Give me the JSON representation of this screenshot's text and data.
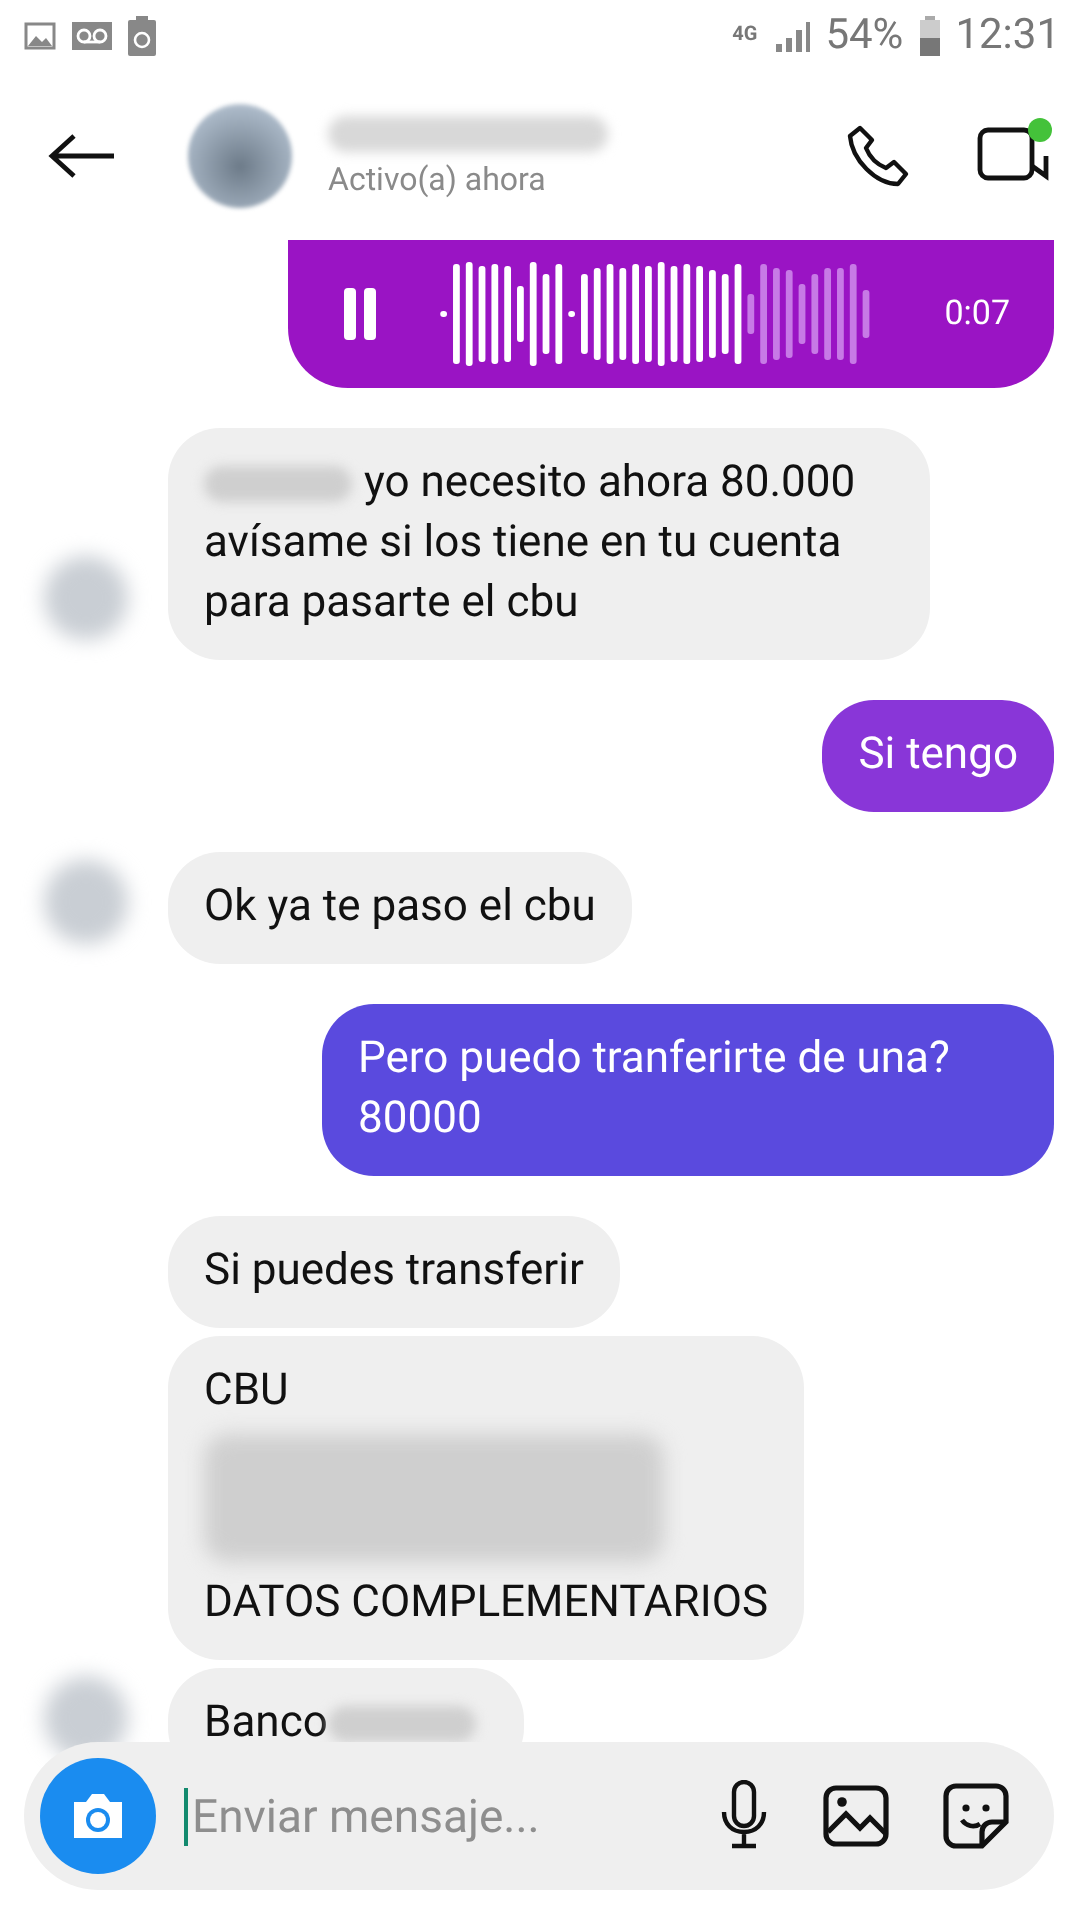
{
  "status_bar": {
    "network": "4G",
    "battery": "54%",
    "time": "12:31"
  },
  "header": {
    "status": "Activo(a) ahora",
    "online": true
  },
  "messages": [
    {
      "kind": "voice",
      "duration": "0:07",
      "level": 0.72
    },
    {
      "kind": "incoming",
      "avatar": true,
      "content": [
        {
          "kind": "redacted"
        },
        {
          "kind": "text",
          "text": "yo necesito ahora 80.000"
        },
        {
          "kind": "line",
          "text": "avísame si los tiene en tu cuenta para pasarte el cbu"
        }
      ]
    },
    {
      "kind": "outgoing",
      "color": "#8936d8",
      "content": [
        {
          "kind": "text",
          "text": "Si tengo"
        }
      ]
    },
    {
      "kind": "incoming",
      "avatar": true,
      "content": [
        {
          "kind": "text",
          "text": "Ok ya te paso el cbu"
        }
      ]
    },
    {
      "kind": "outgoing",
      "color": "#5a4ade",
      "content": [
        {
          "kind": "text",
          "text": "Pero puedo tranferirte de una? 80000"
        }
      ]
    },
    {
      "kind": "incoming",
      "avatar": false,
      "content": [
        {
          "kind": "text",
          "text": "Si puedes transferir"
        }
      ]
    },
    {
      "kind": "incoming",
      "avatar": false,
      "content": [
        {
          "kind": "line",
          "text": "CBU"
        },
        {
          "kind": "redacted_block"
        },
        {
          "kind": "line",
          "text": "DATOS COMPLEMENTARIOS"
        }
      ]
    },
    {
      "kind": "incoming",
      "avatar": true,
      "content": [
        {
          "kind": "text",
          "text": "Banco"
        },
        {
          "kind": "redacted"
        }
      ]
    }
  ],
  "composer": {
    "placeholder": "Enviar mensaje..."
  }
}
